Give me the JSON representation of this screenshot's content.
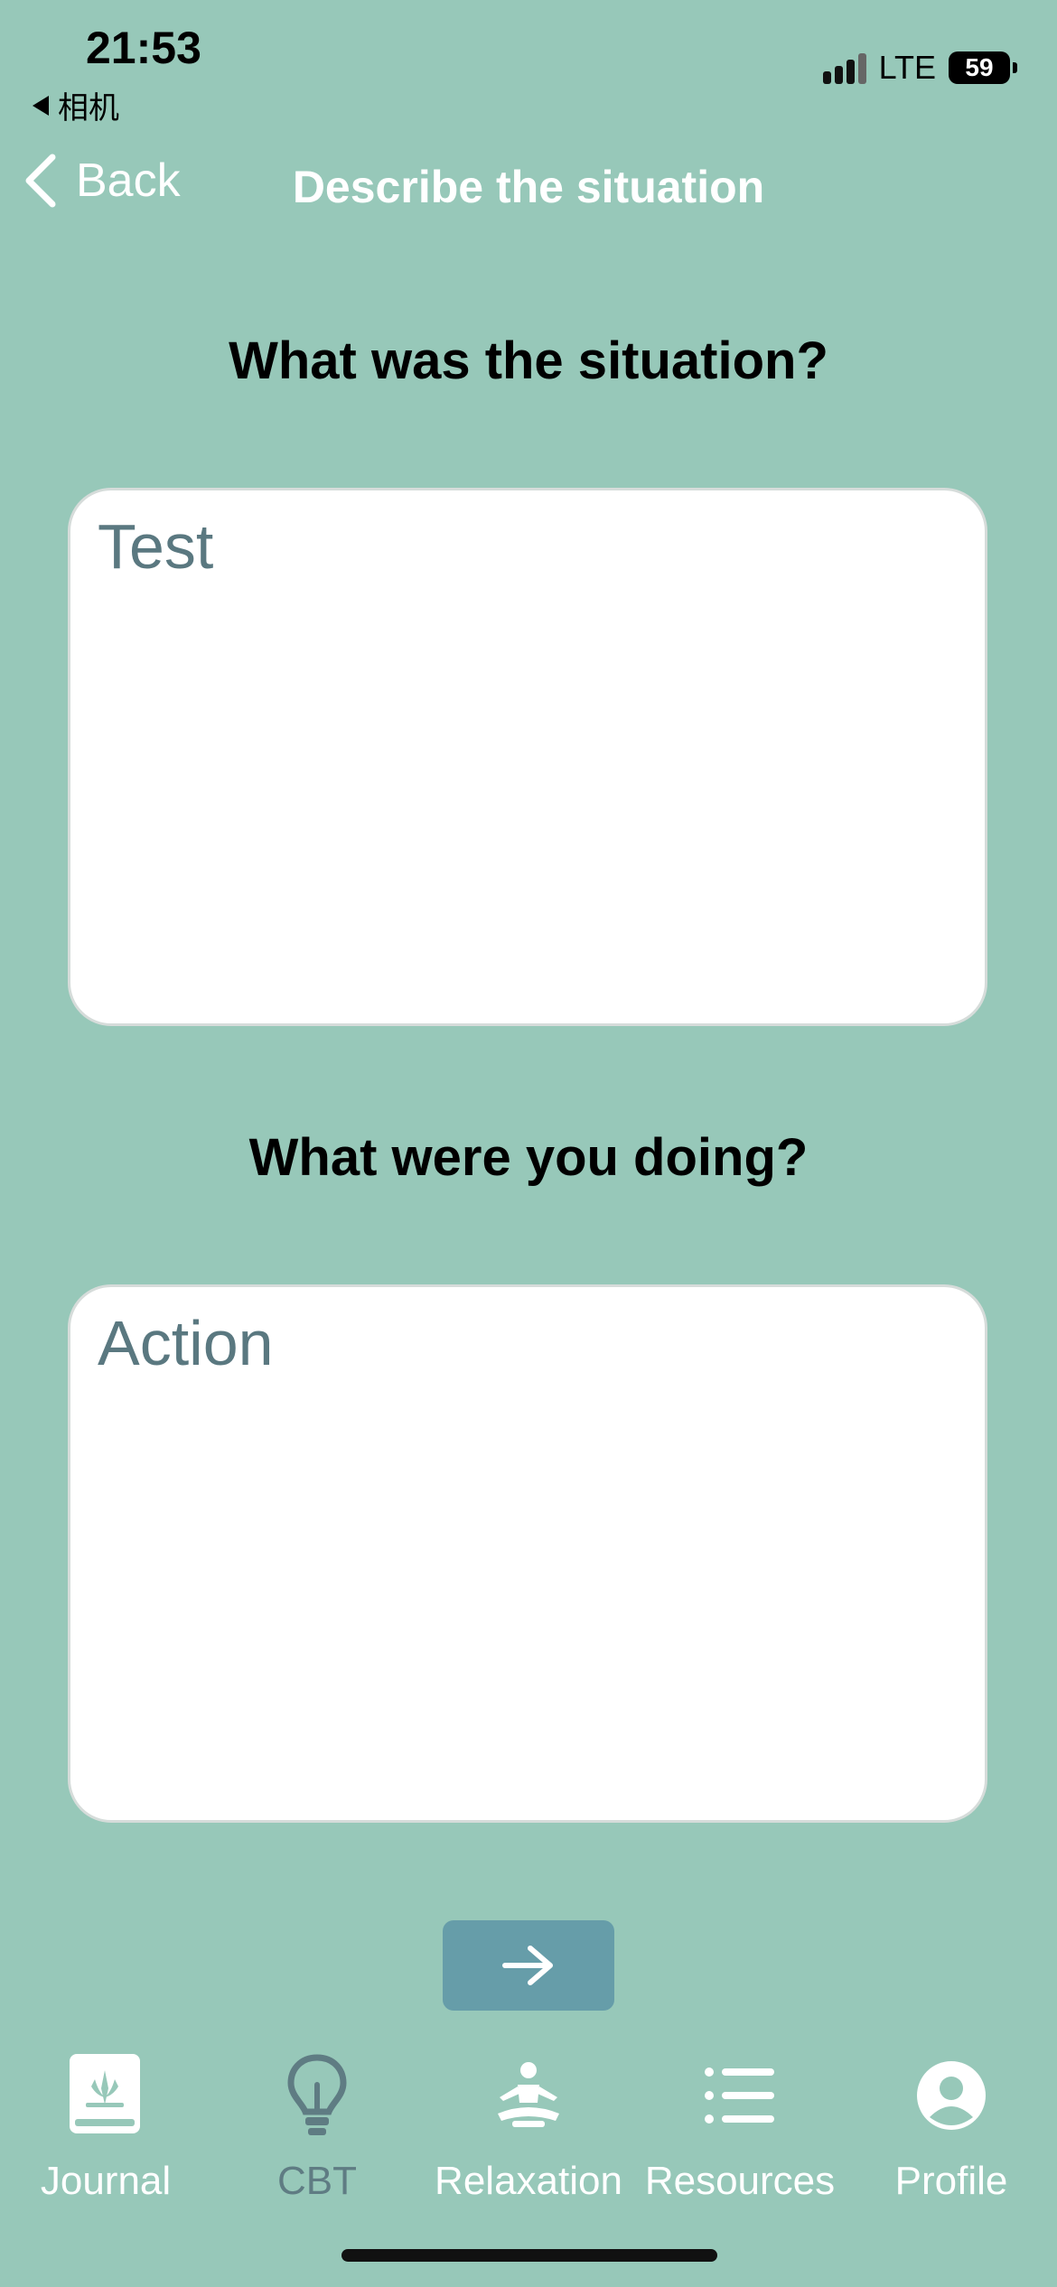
{
  "status_bar": {
    "time": "21:53",
    "back_app": "相机",
    "network": "LTE",
    "battery": "59"
  },
  "nav": {
    "back_label": "Back",
    "title": "Describe the situation"
  },
  "questions": [
    {
      "label": "What was the situation?",
      "value": "Test"
    },
    {
      "label": "What were you doing?",
      "value": "Action"
    }
  ],
  "next_button": {
    "icon": "arrow-right-icon"
  },
  "tabs": [
    {
      "label": "Journal",
      "icon": "journal-icon"
    },
    {
      "label": "CBT",
      "icon": "lightbulb-icon"
    },
    {
      "label": "Relaxation",
      "icon": "meditation-icon"
    },
    {
      "label": "Resources",
      "icon": "list-icon"
    },
    {
      "label": "Profile",
      "icon": "profile-icon"
    }
  ],
  "colors": {
    "background": "#97c8b9",
    "button": "#669da9",
    "dim_label": "#5f7c83"
  }
}
